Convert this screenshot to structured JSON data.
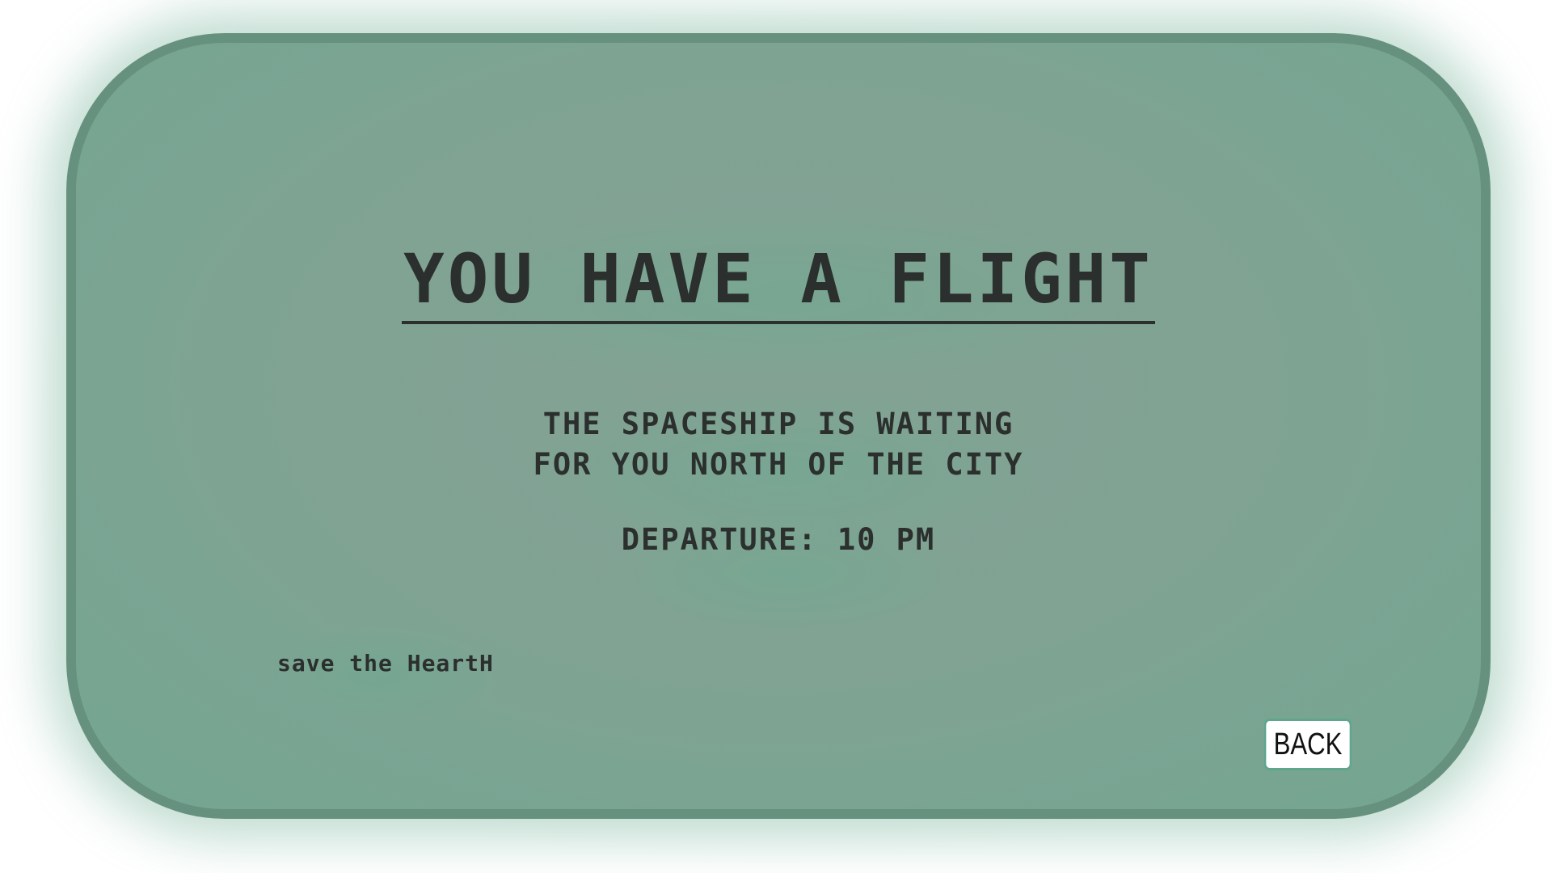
{
  "screen": {
    "title": "YOU HAVE A FLIGHT",
    "message_line1": "THE SPACESHIP IS WAITING",
    "message_line2": "FOR YOU NORTH OF THE CITY",
    "departure": "DEPARTURE: 10 PM",
    "tagline": "save the HeartH",
    "back_label": "BACK"
  },
  "colors": {
    "screen_background": "#7fa393",
    "screen_border": "#66917f",
    "text": "#2b2f2d",
    "button_background": "#ffffff",
    "button_border": "#5ea68c"
  }
}
